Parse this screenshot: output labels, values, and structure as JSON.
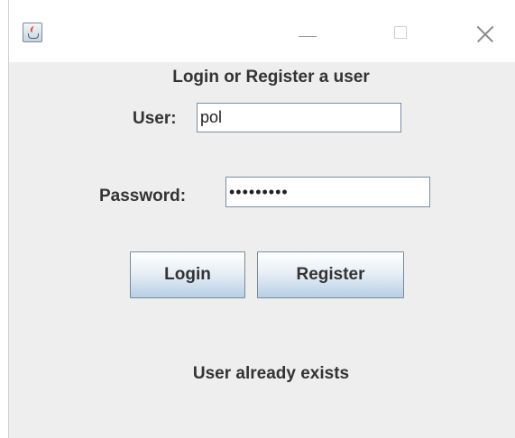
{
  "window": {
    "title": "",
    "icon": "java-cup-icon",
    "controls": {
      "minimize": "minimize-icon",
      "maximize": "maximize-icon",
      "close": "close-icon"
    }
  },
  "form": {
    "heading": "Login or Register a user",
    "user_label": "User:",
    "user_value": "pol",
    "password_label": "Password:",
    "password_value": "•••••••••",
    "login_label": "Login",
    "register_label": "Register"
  },
  "status": {
    "message": "User already exists"
  },
  "colors": {
    "background": "#eeeeee",
    "titlebar": "#ffffff",
    "field_border": "#7a8ca8",
    "button_gradient_bottom": "#b8cfe5"
  }
}
